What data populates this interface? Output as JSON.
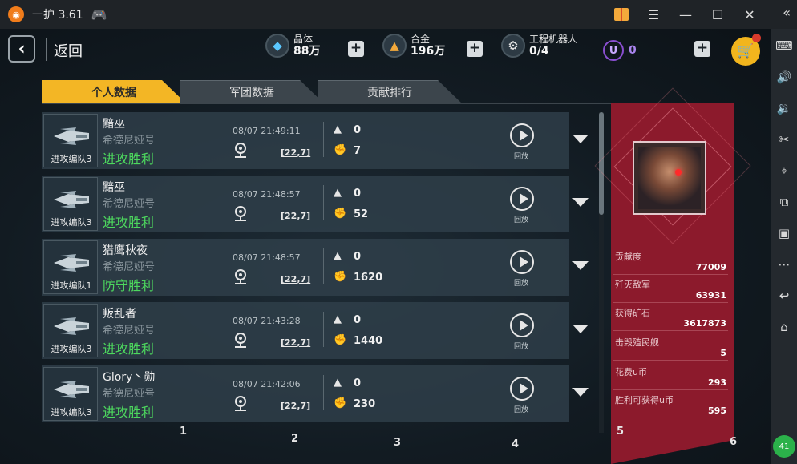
{
  "window": {
    "title": "一护 3.61"
  },
  "nav": {
    "back_label": "返回"
  },
  "resources": {
    "crystal": {
      "label": "晶体",
      "value": "88万"
    },
    "alloy": {
      "label": "合金",
      "value": "196万"
    },
    "robots": {
      "label": "工程机器人",
      "value": "0/4"
    },
    "ucoin": {
      "symbol": "U",
      "value": "0"
    }
  },
  "tabs": [
    {
      "label": "个人数据",
      "active": true
    },
    {
      "label": "军团数据",
      "active": false
    },
    {
      "label": "贡献排行",
      "active": false
    }
  ],
  "replay_label": "回放",
  "battles": [
    {
      "unit": "进攻编队3",
      "name": "黯巫",
      "location": "希德尼娅号",
      "result": "进攻胜利",
      "time": "08/07 21:49:11",
      "coord": "[22,7]",
      "losses": "0",
      "kills": "7"
    },
    {
      "unit": "进攻编队3",
      "name": "黯巫",
      "location": "希德尼娅号",
      "result": "进攻胜利",
      "time": "08/07 21:48:57",
      "coord": "[22,7]",
      "losses": "0",
      "kills": "52"
    },
    {
      "unit": "进攻编队1",
      "name": "猎鹰秋夜",
      "location": "希德尼娅号",
      "result": "防守胜利",
      "time": "08/07 21:48:57",
      "coord": "[22,7]",
      "losses": "0",
      "kills": "1620"
    },
    {
      "unit": "进攻编队3",
      "name": "叛乱者",
      "location": "希德尼娅号",
      "result": "进攻胜利",
      "time": "08/07 21:43:28",
      "coord": "[22,7]",
      "losses": "0",
      "kills": "1440"
    },
    {
      "unit": "进攻编队3",
      "name": "Glory丶勋",
      "location": "希德尼娅号",
      "result": "进攻胜利",
      "time": "08/07 21:42:06",
      "coord": "[22,7]",
      "losses": "0",
      "kills": "230"
    }
  ],
  "stats": [
    {
      "label": "贡献度",
      "value": "77009"
    },
    {
      "label": "歼灭敌军",
      "value": "63931"
    },
    {
      "label": "获得矿石",
      "value": "3617873"
    },
    {
      "label": "击毁殖民舰",
      "value": "5"
    },
    {
      "label": "花费u币",
      "value": "293"
    },
    {
      "label": "胜利可获得u币",
      "value": "595"
    }
  ],
  "column_markers": [
    "1",
    "2",
    "3",
    "4",
    "5",
    "6"
  ],
  "badge": "41",
  "colors": {
    "accent": "#f3b625",
    "victory": "#4dd85e",
    "panel": "#8c1a2c",
    "ucoin": "#a984ee"
  }
}
